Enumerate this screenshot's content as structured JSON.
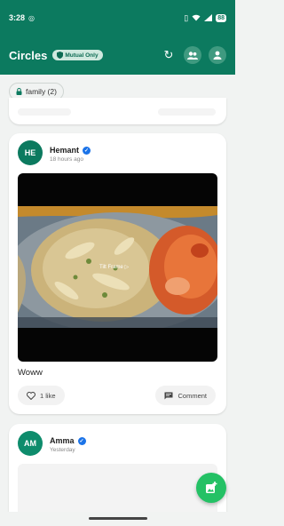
{
  "status_bar": {
    "time": "3:28",
    "battery": "88"
  },
  "header": {
    "title": "Circles",
    "filter_pill": "Mutual Only"
  },
  "filter_chip": {
    "label": "family (2)"
  },
  "posts": [
    {
      "avatar_initials": "HE",
      "author": "Hemant",
      "time": "18 hours ago",
      "image_overlay_text": "Tilt Frame ▷",
      "caption": "Woww",
      "like_label": "1 like",
      "comment_label": "Comment"
    },
    {
      "avatar_initials": "AM",
      "author": "Amma",
      "time": "Yesterday"
    }
  ],
  "colors": {
    "brand": "#0c7a5f",
    "fab": "#24c165",
    "verified": "#1b73e8"
  }
}
